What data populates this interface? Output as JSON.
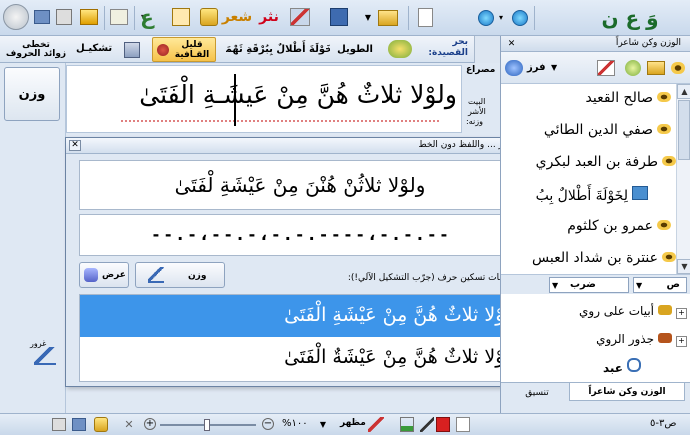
{
  "toolbar": {
    "icons": [
      "logo-icon",
      "arrow-right-nav-icon",
      "arrow-left-nav-icon",
      "new-doc-icon",
      "open-folder-icon",
      "save-icon",
      "tools-icon",
      "prose-icon",
      "poetry-icon",
      "print-icon",
      "mail-icon",
      "help-icon"
    ],
    "prose_label": "نثر",
    "poetry_label": "شعر"
  },
  "ribbon": {
    "remove_extra": "تخطى\nزوائد الحروف",
    "tashkeel": "تشكيـل",
    "qaliq": "قليل\nالقـافية",
    "long_label": "الطويل",
    "poem_label": "لِخَوْلَةَ أَطْلالٌ بِبُرْقَةِ ثَهْمَدِ",
    "sea_label": "بحر",
    "qasida_label": "القصيدة:"
  },
  "editor": {
    "verse": "ولوْلا ثلاثٌ هُنَّ مِنْ عَيشَـةِ الْفَتَىٰ",
    "wazn_button": "وزن",
    "misra_label": "مصراع",
    "bayt_label": "البيت",
    "ashr_label": "الأشر",
    "wazn_label": "وزنه:"
  },
  "dialog": {
    "title": "الترميز ... واللفظ دون الخط",
    "encoded_text": "ولوْلا ثلاثُنْ هُنْنَ مِنْ عَيْشَةِ لْفَتَىٰ",
    "metre_pattern": "- - . - ، - - . - ، - . - . - - - - ، - . - . - -",
    "suggestions_label": "مقترحات تسكين حرف (جرّب التشكيل الآلي!):",
    "wazn_button": "وزن",
    "show_button": "عرض",
    "suggestions": [
      "ولوْلا ثلاثٌ هُنَّ مِنْ عَيْشَةِ الْفَتَىٰ",
      "ولوْلا ثلاثٌ هُنَّ مِنْ عَيْشَةٌ الْفَتَىٰ"
    ]
  },
  "panel": {
    "title": "الوزن وكن شاعراً",
    "faraz_label": "فرز",
    "poets": [
      "صالح القعيد",
      "صفي الدين الطائي",
      "طرفة بن العبد لبكري",
      "لِخَوْلَةَ أَطْلالٌ بِبُ",
      "عمرو بن كلثوم",
      "عنترة بن شداد العبس"
    ],
    "filter_label": "ص",
    "filter_value": "ضرب",
    "tree_items": [
      "أبيات على روي",
      "جذور الروي",
      "عبد"
    ],
    "tabs": [
      "الوزن وكن شاعراً",
      "تنسيق"
    ]
  },
  "left_tools": {
    "label": "غرور"
  },
  "statusbar": {
    "zoom": "%١٠٠",
    "view_label": "مظهر",
    "position": "ص٣-٥"
  }
}
